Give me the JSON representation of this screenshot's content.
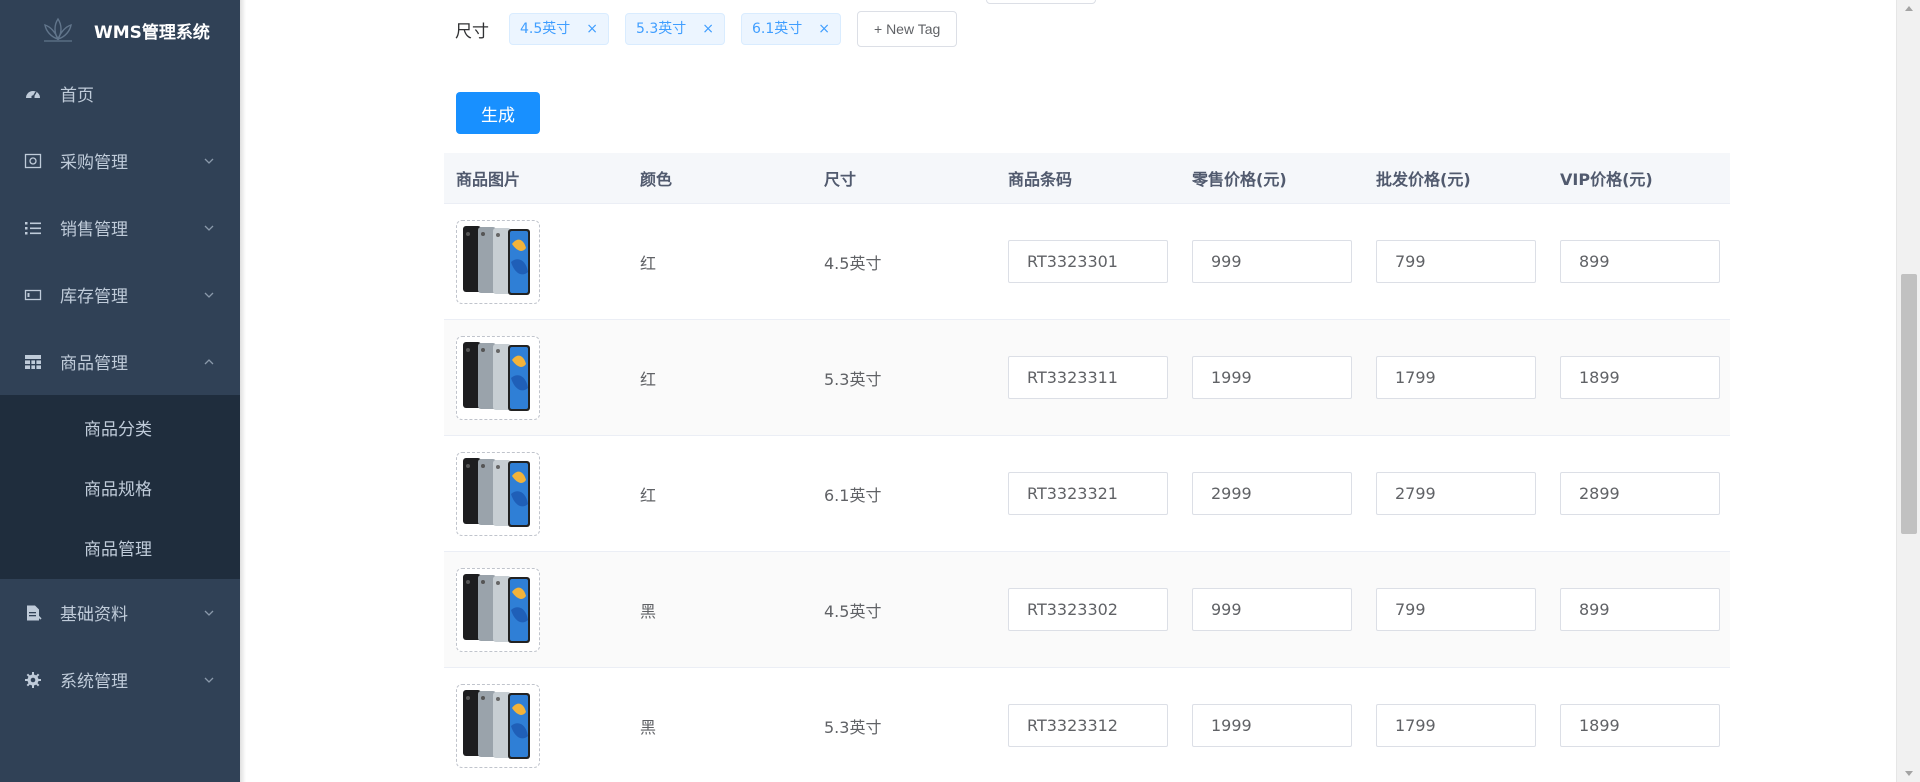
{
  "app": {
    "title": "WMS管理系统"
  },
  "sidebar": {
    "items": [
      {
        "label": "首页",
        "icon": "dashboard-icon",
        "expandable": false
      },
      {
        "label": "采购管理",
        "icon": "purchase-icon",
        "expandable": true
      },
      {
        "label": "销售管理",
        "icon": "list-icon",
        "expandable": true
      },
      {
        "label": "库存管理",
        "icon": "inventory-icon",
        "expandable": true
      },
      {
        "label": "商品管理",
        "icon": "grid-icon",
        "expandable": true,
        "expanded": true,
        "children": [
          {
            "label": "商品分类"
          },
          {
            "label": "商品规格"
          },
          {
            "label": "商品管理"
          }
        ]
      },
      {
        "label": "基础资料",
        "icon": "document-icon",
        "expandable": true
      },
      {
        "label": "系统管理",
        "icon": "gear-icon",
        "expandable": true
      }
    ]
  },
  "size": {
    "label": "尺寸",
    "tags": [
      "4.5英寸",
      "5.3英寸",
      "6.1英寸"
    ],
    "close_glyph": "×",
    "new_tag": "+ New Tag"
  },
  "generate_button": "生成",
  "table": {
    "headers": [
      "商品图片",
      "颜色",
      "尺寸",
      "商品条码",
      "零售价格(元)",
      "批发价格(元)",
      "VIP价格(元)"
    ],
    "rows": [
      {
        "color": "红",
        "size": "4.5英寸",
        "barcode": "RT3323301",
        "retail": "999",
        "wholesale": "799",
        "vip": "899"
      },
      {
        "color": "红",
        "size": "5.3英寸",
        "barcode": "RT3323311",
        "retail": "1999",
        "wholesale": "1799",
        "vip": "1899"
      },
      {
        "color": "红",
        "size": "6.1英寸",
        "barcode": "RT3323321",
        "retail": "2999",
        "wholesale": "2799",
        "vip": "2899"
      },
      {
        "color": "黑",
        "size": "4.5英寸",
        "barcode": "RT3323302",
        "retail": "999",
        "wholesale": "799",
        "vip": "899"
      },
      {
        "color": "黑",
        "size": "5.3英寸",
        "barcode": "RT3323312",
        "retail": "1999",
        "wholesale": "1799",
        "vip": "1899"
      }
    ]
  },
  "colors": {
    "sidebar_bg": "#304156",
    "submenu_bg": "#1f2d3d",
    "primary": "#1890ff",
    "tag_bg": "#ecf5ff",
    "tag_text": "#409eff"
  }
}
